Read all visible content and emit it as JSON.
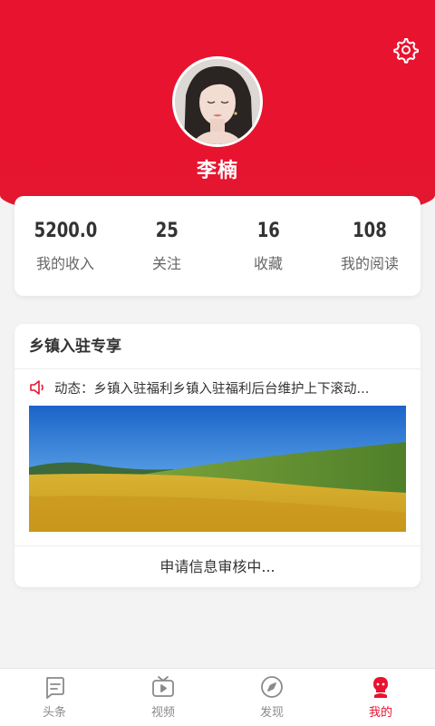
{
  "profile": {
    "name": "李楠"
  },
  "stats": [
    {
      "value": "5200.0",
      "label": "我的收入"
    },
    {
      "value": "25",
      "label": "关注"
    },
    {
      "value": "16",
      "label": "收藏"
    },
    {
      "value": "108",
      "label": "我的阅读"
    }
  ],
  "exclusive": {
    "title": "乡镇入驻专享",
    "news": "动态：乡镇入驻福利乡镇入驻福利后台维护上下滚动...",
    "status": "申请信息审核中..."
  },
  "tabs": [
    {
      "label": "头条",
      "icon": "headline-icon"
    },
    {
      "label": "视频",
      "icon": "tv-icon"
    },
    {
      "label": "发现",
      "icon": "compass-icon"
    },
    {
      "label": "我的",
      "icon": "profile-icon"
    }
  ],
  "active_tab": "我的",
  "colors": {
    "accent": "#e8132f",
    "tab_inactive": "#8a8a8a"
  }
}
